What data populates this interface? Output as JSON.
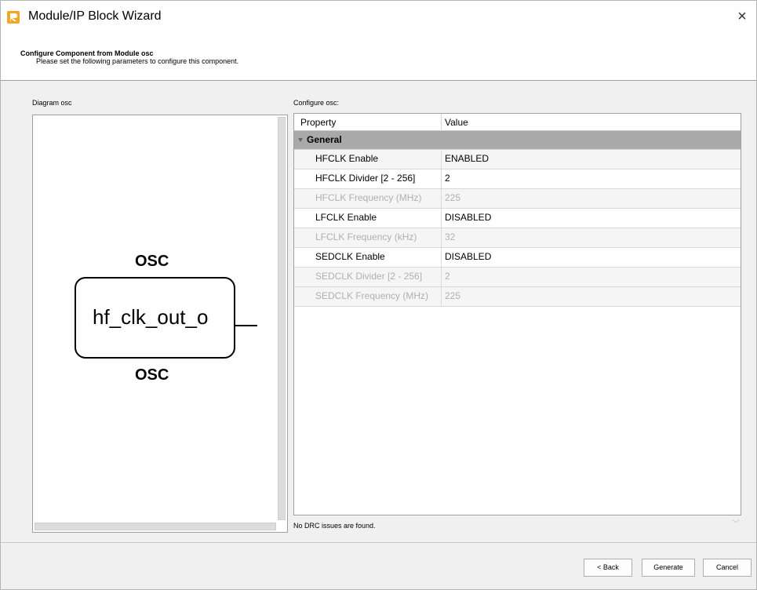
{
  "window": {
    "title": "Module/IP Block Wizard",
    "close_icon": "×"
  },
  "header": {
    "title": "Configure Component from Module osc",
    "subtitle": "Please set the following parameters to configure this component."
  },
  "diagram": {
    "label": "Diagram osc",
    "top_name": "OSC",
    "port_name": "hf_clk_out_o",
    "bottom_name": "OSC"
  },
  "config": {
    "label": "Configure osc:",
    "columns": [
      "Property",
      "Value"
    ],
    "group": "General",
    "rows": [
      {
        "property": "HFCLK Enable",
        "value": "ENABLED",
        "enabled": true
      },
      {
        "property": "HFCLK Divider  [2 - 256]",
        "value": "2",
        "enabled": true
      },
      {
        "property": "HFCLK Frequency (MHz)",
        "value": "225",
        "enabled": false
      },
      {
        "property": "LFCLK Enable",
        "value": "DISABLED",
        "enabled": true
      },
      {
        "property": "LFCLK Frequency (kHz)",
        "value": "32",
        "enabled": false
      },
      {
        "property": "SEDCLK Enable",
        "value": "DISABLED",
        "enabled": true
      },
      {
        "property": "SEDCLK Divider  [2 - 256]",
        "value": "2",
        "enabled": false
      },
      {
        "property": "SEDCLK Frequency (MHz)",
        "value": "225",
        "enabled": false
      }
    ]
  },
  "status": {
    "drc_message": "No DRC issues are found."
  },
  "buttons": {
    "back": "< Back",
    "generate": "Generate",
    "cancel": "Cancel"
  },
  "colors": {
    "group_row": "#a9a9a9",
    "disabled_text": "#b0b0b0",
    "app_icon": "#f5a623"
  }
}
